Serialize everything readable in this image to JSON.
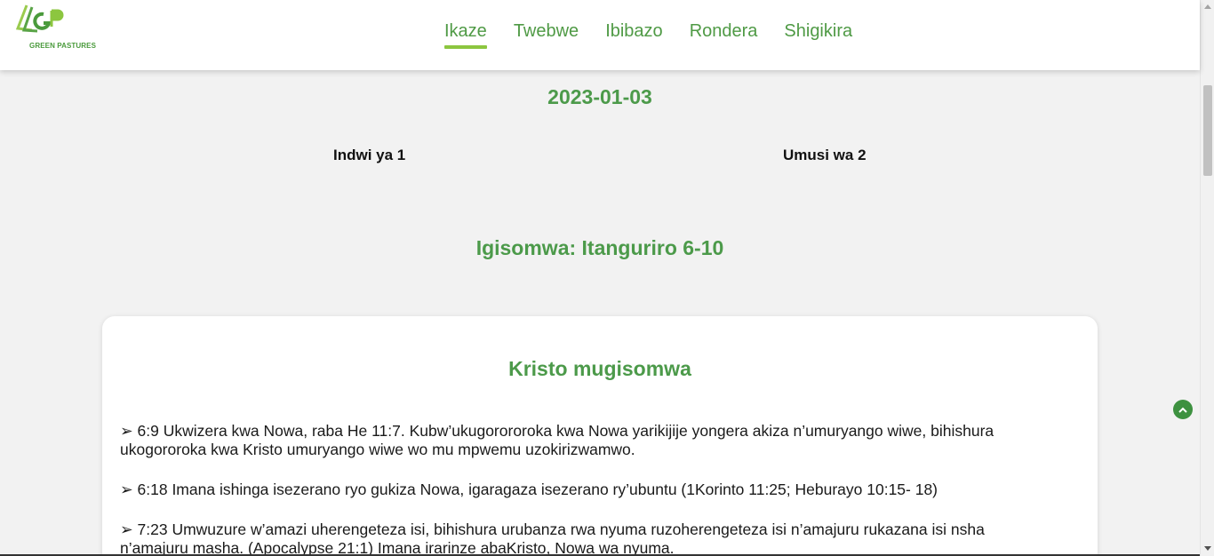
{
  "header": {
    "logo_text": "GREEN PASTURES",
    "logo_mark": "GP",
    "nav": [
      {
        "label": "Ikaze",
        "active": true
      },
      {
        "label": "Twebwe",
        "active": false
      },
      {
        "label": "Ibibazo",
        "active": false
      },
      {
        "label": "Rondera",
        "active": false
      },
      {
        "label": "Shigikira",
        "active": false
      }
    ]
  },
  "content": {
    "date": "2023-01-03",
    "week": "Indwi ya 1",
    "day": "Umusi wa 2",
    "reading": "Igisomwa: Itanguriro 6-10",
    "card": {
      "title": "Kristo mugisomwa",
      "paragraphs": [
        "➢ 6:9 Ukwizera kwa Nowa, raba He 11:7. Kubw’ukugorororoka kwa Nowa yarikijije yongera akiza n’umuryango wiwe, bihishura ukogororoka kwa Kristo umuryango wiwe wo mu mpwemu uzokirizwamwo.",
        "➢ 6:18 Imana ishinga isezerano ryo gukiza Nowa, igaragaza isezerano ry’ubuntu (1Korinto 11:25; Heburayo 10:15- 18)",
        "➢ 7:23 Umwuzure w’amazi uherengeteza isi, bihishura urubanza rwa nyuma ruzoherengeteza isi n’amajuru rukazana isi nsha n’amajuru masha. (Apocalypse 21:1) Imana irarinze abaKristo, Nowa wa nyuma."
      ]
    }
  },
  "icons": {
    "fab": "chevron-up-icon",
    "scroll_up": "scroll-up-arrow-icon",
    "scroll_down": "scroll-down-arrow-icon"
  },
  "colors": {
    "brand_green": "#4c9a4a",
    "nav_underline": "#8cc63f",
    "fab": "#3d9140"
  }
}
